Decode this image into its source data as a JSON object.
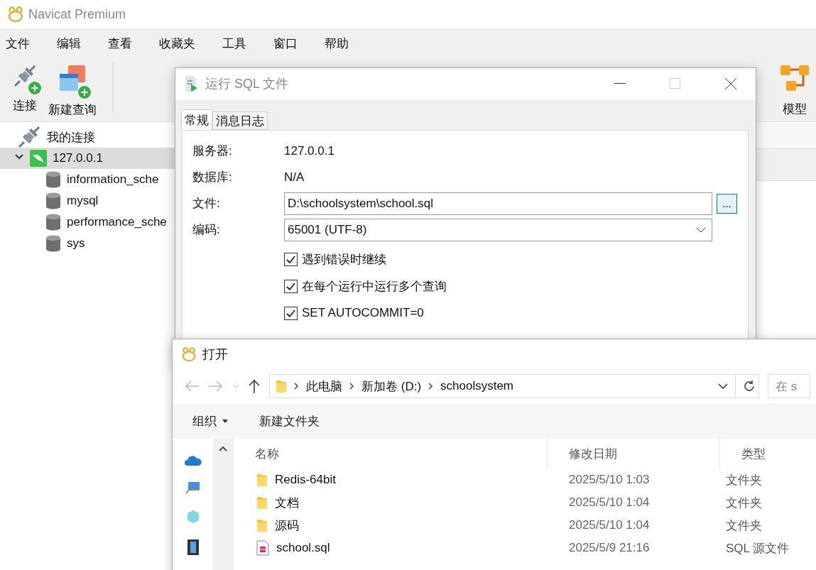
{
  "app": {
    "title": "Navicat Premium"
  },
  "menu": [
    "文件",
    "编辑",
    "查看",
    "收藏夹",
    "工具",
    "窗口",
    "帮助"
  ],
  "toolbar": [
    {
      "label": "连接",
      "kind": "connect"
    },
    {
      "label": "新建查询",
      "kind": "query"
    },
    {
      "label": "模型",
      "kind": "model"
    }
  ],
  "tree": {
    "label": "我的连接",
    "children": [
      {
        "label": "127.0.0.1",
        "selected": true,
        "expanded": true,
        "children": [
          {
            "label": "information_sche"
          },
          {
            "label": "mysql"
          },
          {
            "label": "performance_sche"
          },
          {
            "label": "sys"
          }
        ]
      }
    ]
  },
  "run_sql_dialog": {
    "title": "运行 SQL 文件",
    "tabs": [
      {
        "label": "常规",
        "selected": true
      },
      {
        "label": "消息日志",
        "selected": false
      }
    ],
    "fields": [
      {
        "label": "服务器:",
        "value": "127.0.0.1",
        "kind": "text"
      },
      {
        "label": "数据库:",
        "value": "N/A",
        "kind": "text"
      },
      {
        "label": "文件:",
        "value": "D:\\schoolsystem\\school.sql",
        "kind": "file",
        "button": "..."
      },
      {
        "label": "编码:",
        "value": "65001 (UTF-8)",
        "kind": "select"
      }
    ],
    "options": [
      {
        "label": "遇到错误时继续",
        "checked": true
      },
      {
        "label": "在每个运行中运行多个查询",
        "checked": true
      },
      {
        "label": "SET AUTOCOMMIT=0",
        "checked": true
      }
    ]
  },
  "open_dialog": {
    "title": "打开",
    "path": [
      "此电脑",
      "新加卷 (D:)",
      "schoolsystem"
    ],
    "search": {
      "placeholder": "在 s"
    },
    "commands": [
      {
        "label": "组织",
        "kind": "menu"
      },
      {
        "label": "新建文件夹",
        "kind": "plain"
      }
    ],
    "columns": [
      "名称",
      "修改日期",
      "类型"
    ],
    "files": [
      {
        "name": "Redis-64bit",
        "modified": "2025/5/10 1:03",
        "type": "文件夹",
        "kind": "folder"
      },
      {
        "name": "文档",
        "modified": "2025/5/10 1:04",
        "type": "文件夹",
        "kind": "folder"
      },
      {
        "name": "源码",
        "modified": "2025/5/10 1:04",
        "type": "文件夹",
        "kind": "folder"
      },
      {
        "name": "school.sql",
        "modified": "2025/5/9 21:16",
        "type": "SQL 源文件",
        "kind": "sql"
      }
    ]
  }
}
